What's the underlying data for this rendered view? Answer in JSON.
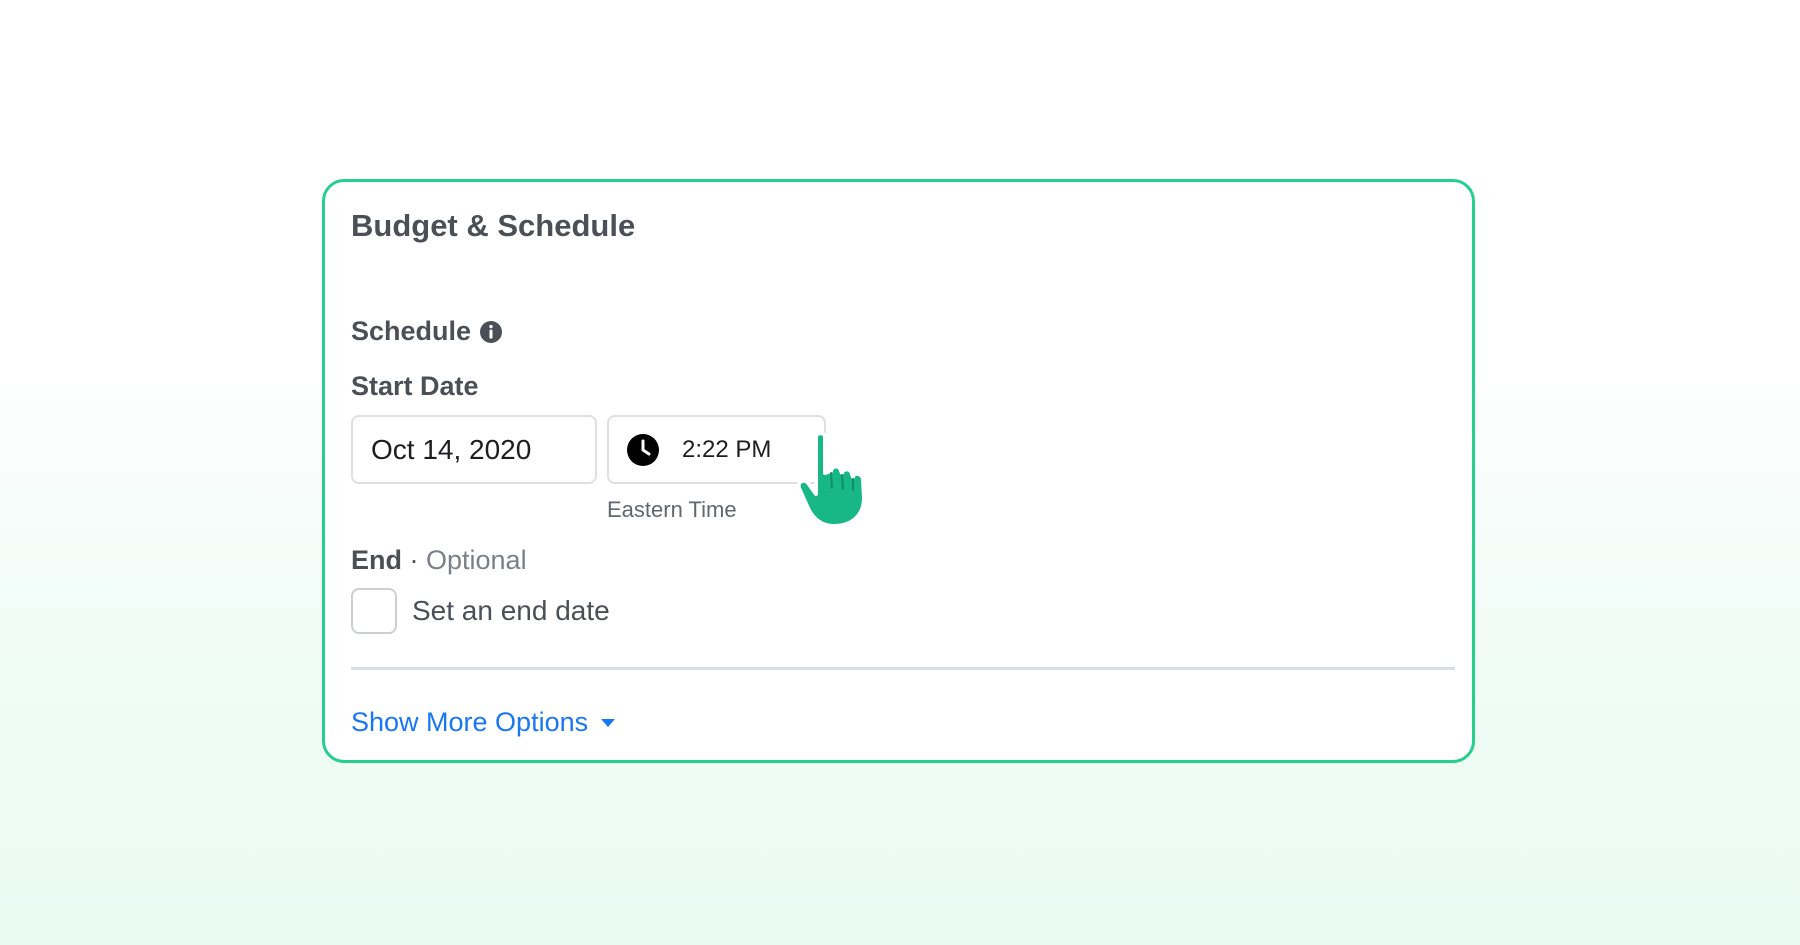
{
  "card": {
    "title": "Budget & Schedule",
    "border_color": "#25d08f"
  },
  "schedule": {
    "label": "Schedule",
    "info_icon": "info-icon"
  },
  "start": {
    "label": "Start Date",
    "date_value": "Oct 14, 2020",
    "time_value": "2:22 PM",
    "time_icon": "clock-icon",
    "timezone": "Eastern Time",
    "cursor_icon": "hand-pointer-icon",
    "cursor_color": "#17b886"
  },
  "end": {
    "label": "End",
    "separator": " · ",
    "optional": "Optional",
    "checkbox_label": "Set an end date",
    "checked": false
  },
  "more_options": {
    "label": "Show More Options",
    "icon": "caret-down-icon",
    "color": "#1877f2"
  }
}
